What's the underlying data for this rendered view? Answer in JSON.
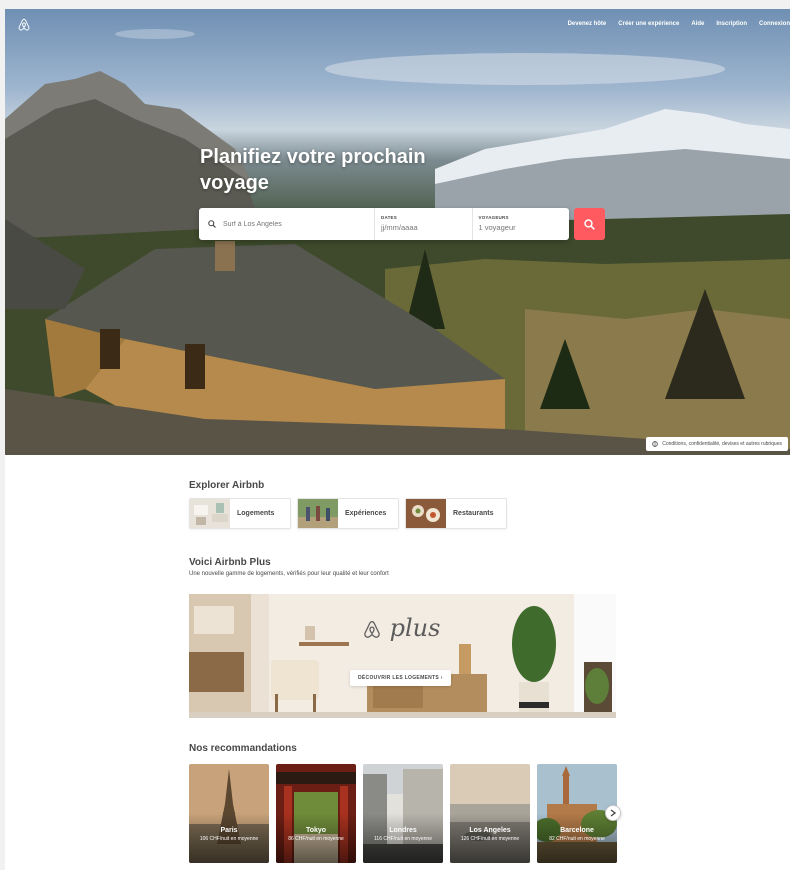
{
  "nav": {
    "items": [
      "Devenez hôte",
      "Créer une expérience",
      "Aide",
      "Inscription",
      "Connexion"
    ]
  },
  "hero": {
    "title": "Planifiez votre prochain voyage",
    "search": {
      "where_placeholder": "Surf à Los Angeles",
      "dates_label": "DATES",
      "dates_value": "jj/mm/aaaa",
      "guests_label": "VOYAGEURS",
      "guests_value": "1 voyageur"
    },
    "footer_link": "Conditions, confidentialité, devises et autres rubriques"
  },
  "explore": {
    "title": "Explorer Airbnb",
    "items": [
      {
        "label": "Logements"
      },
      {
        "label": "Expériences"
      },
      {
        "label": "Restaurants"
      }
    ]
  },
  "plus": {
    "title": "Voici Airbnb Plus",
    "subtitle": "Une nouvelle gamme de logements, vérifiés pour leur qualité et leur confort",
    "brand_text": "plus",
    "button_label": "DÉCOUVRIR LES LOGEMENTS ›"
  },
  "recommendations": {
    "title": "Nos recommandations",
    "items": [
      {
        "city": "Paris",
        "price": "106 CHF/nuit en moyenne"
      },
      {
        "city": "Tokyo",
        "price": "86 CHF/nuit en moyenne"
      },
      {
        "city": "Londres",
        "price": "116 CHF/nuit en moyenne"
      },
      {
        "city": "Los Angeles",
        "price": "126 CHF/nuit en moyenne"
      },
      {
        "city": "Barcelone",
        "price": "82 CHF/nuit en moyenne"
      }
    ]
  },
  "colors": {
    "brand": "#ff5a5f",
    "text": "#484848"
  }
}
